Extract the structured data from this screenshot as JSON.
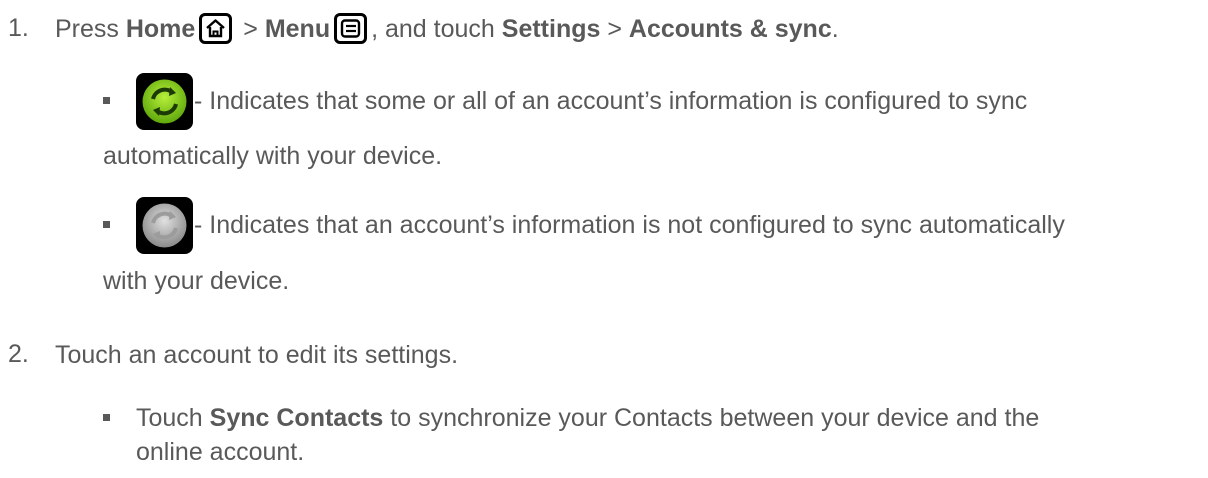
{
  "steps": [
    {
      "number": "1.",
      "segments": {
        "press": "Press ",
        "home": "Home",
        "gt1": " > ",
        "menu": "Menu",
        "touch": ", and touch ",
        "settings": "Settings",
        "gt2": " > ",
        "accounts": "Accounts & sync",
        "end": "."
      },
      "bullets": [
        {
          "icon": "sync-on-icon",
          "line1": " - Indicates that some or all of an account’s information is configured to sync",
          "line2": "automatically with your device."
        },
        {
          "icon": "sync-off-icon",
          "line1": " - Indicates that an account’s information is not configured to sync automatically",
          "line2": "with your device."
        }
      ]
    },
    {
      "number": "2.",
      "text": "Touch an account to edit its settings.",
      "bullets": [
        {
          "touch": "Touch ",
          "bold": "Sync Contacts",
          "line1": " to synchronize your Contacts between your device and the",
          "line2": "online account."
        }
      ]
    }
  ],
  "icons": {
    "home_key": "home-key-icon",
    "menu_key": "menu-key-icon"
  },
  "colors": {
    "text": "#595959",
    "sync_on": "#8fd118",
    "sync_off": "#b5b5b5"
  }
}
